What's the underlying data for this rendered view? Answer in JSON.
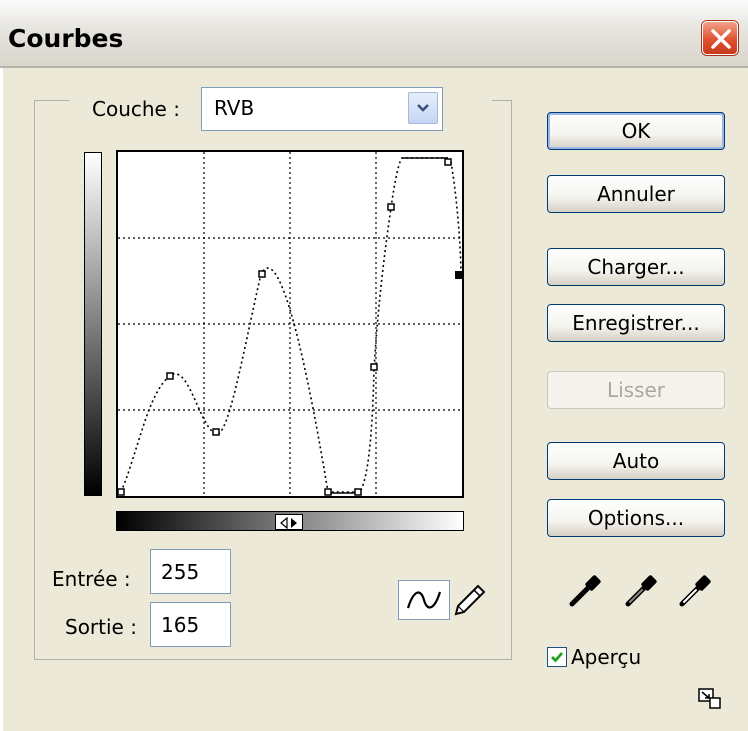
{
  "window": {
    "title": "Courbes"
  },
  "channel": {
    "label": "Couche :",
    "value": "RVB"
  },
  "fields": {
    "input_label": "Entrée :",
    "input_value": "255",
    "output_label": "Sortie :",
    "output_value": "165"
  },
  "buttons": {
    "ok": "OK",
    "cancel": "Annuler",
    "load": "Charger...",
    "save": "Enregistrer...",
    "smooth": "Lisser",
    "auto": "Auto",
    "options": "Options..."
  },
  "preview": {
    "label": "Aperçu",
    "checked": true
  },
  "icons": {
    "close": "close-icon",
    "dropdown": "chevron-down-icon",
    "curve_tool": "curve-tool-icon",
    "pencil_tool": "pencil-icon",
    "black_eyedropper": "eyedropper-icon",
    "gray_eyedropper": "eyedropper-icon",
    "white_eyedropper": "eyedropper-icon",
    "resize": "resize-icon"
  }
}
